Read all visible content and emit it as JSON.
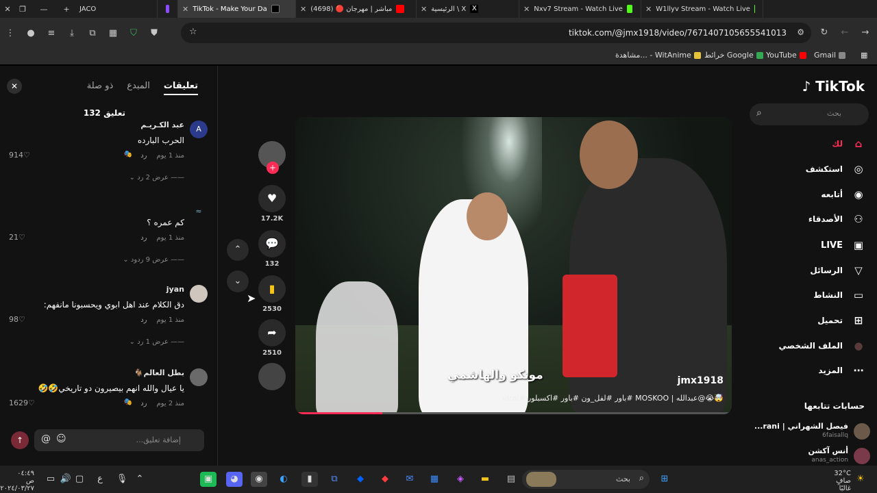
{
  "browser": {
    "tabs": [
      {
        "label": "JACO",
        "active": false
      },
      {
        "label": "TikTok - Make Your Da",
        "active": true
      },
      {
        "label": "(4698) 🔴 مباشر | مهرجان",
        "active": false
      },
      {
        "label": "الرئيسية \\ X",
        "active": false
      },
      {
        "label": "Nxv7 Stream - Watch Live",
        "active": false
      },
      {
        "label": "W1llyv Stream - Watch Live",
        "active": false
      }
    ],
    "url": "tiktok.com/@jmx1918/video/7671407105655541013",
    "bookmarks": [
      "Gmail",
      "YouTube",
      "خرائط Google",
      "مشاهدة... - WitAnime"
    ]
  },
  "comments_panel": {
    "tabs": [
      "تعليقات",
      "المبدع",
      "ذو صلة"
    ],
    "count_label": "132 تعليق",
    "comments": [
      {
        "avatar_letter": "A",
        "user": "عبد الكـريـم",
        "text": "الحرب البارده",
        "time": "منذ 1 يوم",
        "reply": "رد",
        "likes": "914",
        "view_replies": "عرض 2 رد"
      },
      {
        "avatar_letter": "",
        "user": "",
        "text": "كم عمره ؟",
        "time": "منذ 1 يوم",
        "reply": "رد",
        "likes": "21",
        "view_replies": "عرض 9 ردود"
      },
      {
        "avatar_letter": "",
        "user": "jyan",
        "text": "دق الكلام عند اهل ابوي ويحسبونا مانفهم:",
        "time": "منذ 1 يوم",
        "reply": "رد",
        "likes": "98",
        "view_replies": "عرض 1 رد"
      },
      {
        "avatar_letter": "",
        "user": "بطل العالم🐐",
        "text": "يا عيال والله انهم بيصيرون دو تاريخي🤣🤣",
        "time": "منذ 2 يوم",
        "reply": "رد",
        "likes": "1629",
        "view_replies": ""
      }
    ],
    "input_placeholder": "إضافة تعليق..."
  },
  "actions": {
    "likes": "17.2K",
    "comments": "132",
    "saves": "2530",
    "shares": "2510"
  },
  "video": {
    "caption_overlay": "مونكو والهاشمي",
    "username": "jmx1918",
    "description": "🤯😭@عبدالله | MOSKOO #باور #لفل_ون #باور #اكسبلور #viral",
    "progress": 0.2
  },
  "sidebar": {
    "logo": "TikTok",
    "search_placeholder": "بحث",
    "nav": [
      {
        "label": "لك",
        "icon": "home-icon",
        "active": true
      },
      {
        "label": "استكشف",
        "icon": "compass-icon",
        "active": false
      },
      {
        "label": "أتابعه",
        "icon": "following-avatar-icon",
        "active": false
      },
      {
        "label": "الأصدقاء",
        "icon": "friends-icon",
        "active": false
      },
      {
        "label": "LIVE",
        "icon": "live-icon",
        "active": false
      },
      {
        "label": "الرسائل",
        "icon": "messages-icon",
        "active": false
      },
      {
        "label": "النشاط",
        "icon": "activity-icon",
        "active": false
      },
      {
        "label": "تحميل",
        "icon": "upload-icon",
        "active": false
      },
      {
        "label": "الملف الشخصي",
        "icon": "profile-icon",
        "active": false
      },
      {
        "label": "المزيد",
        "icon": "more-icon",
        "active": false
      }
    ],
    "following_header": "حسابات تتابعها",
    "following": [
      {
        "name": "فيصل الشهراني | rani...",
        "handle": "6faisallq"
      },
      {
        "name": "أنس آكشن",
        "handle": "anas_action"
      }
    ]
  },
  "taskbar": {
    "search_placeholder": "بحث",
    "weather_temp": "32°C",
    "weather_desc": "صافٍ غالبًا",
    "time": "٠٤:٤٩ ص",
    "date": "٢٠٢٤/٠٣/٢٧",
    "lang": "ع"
  }
}
